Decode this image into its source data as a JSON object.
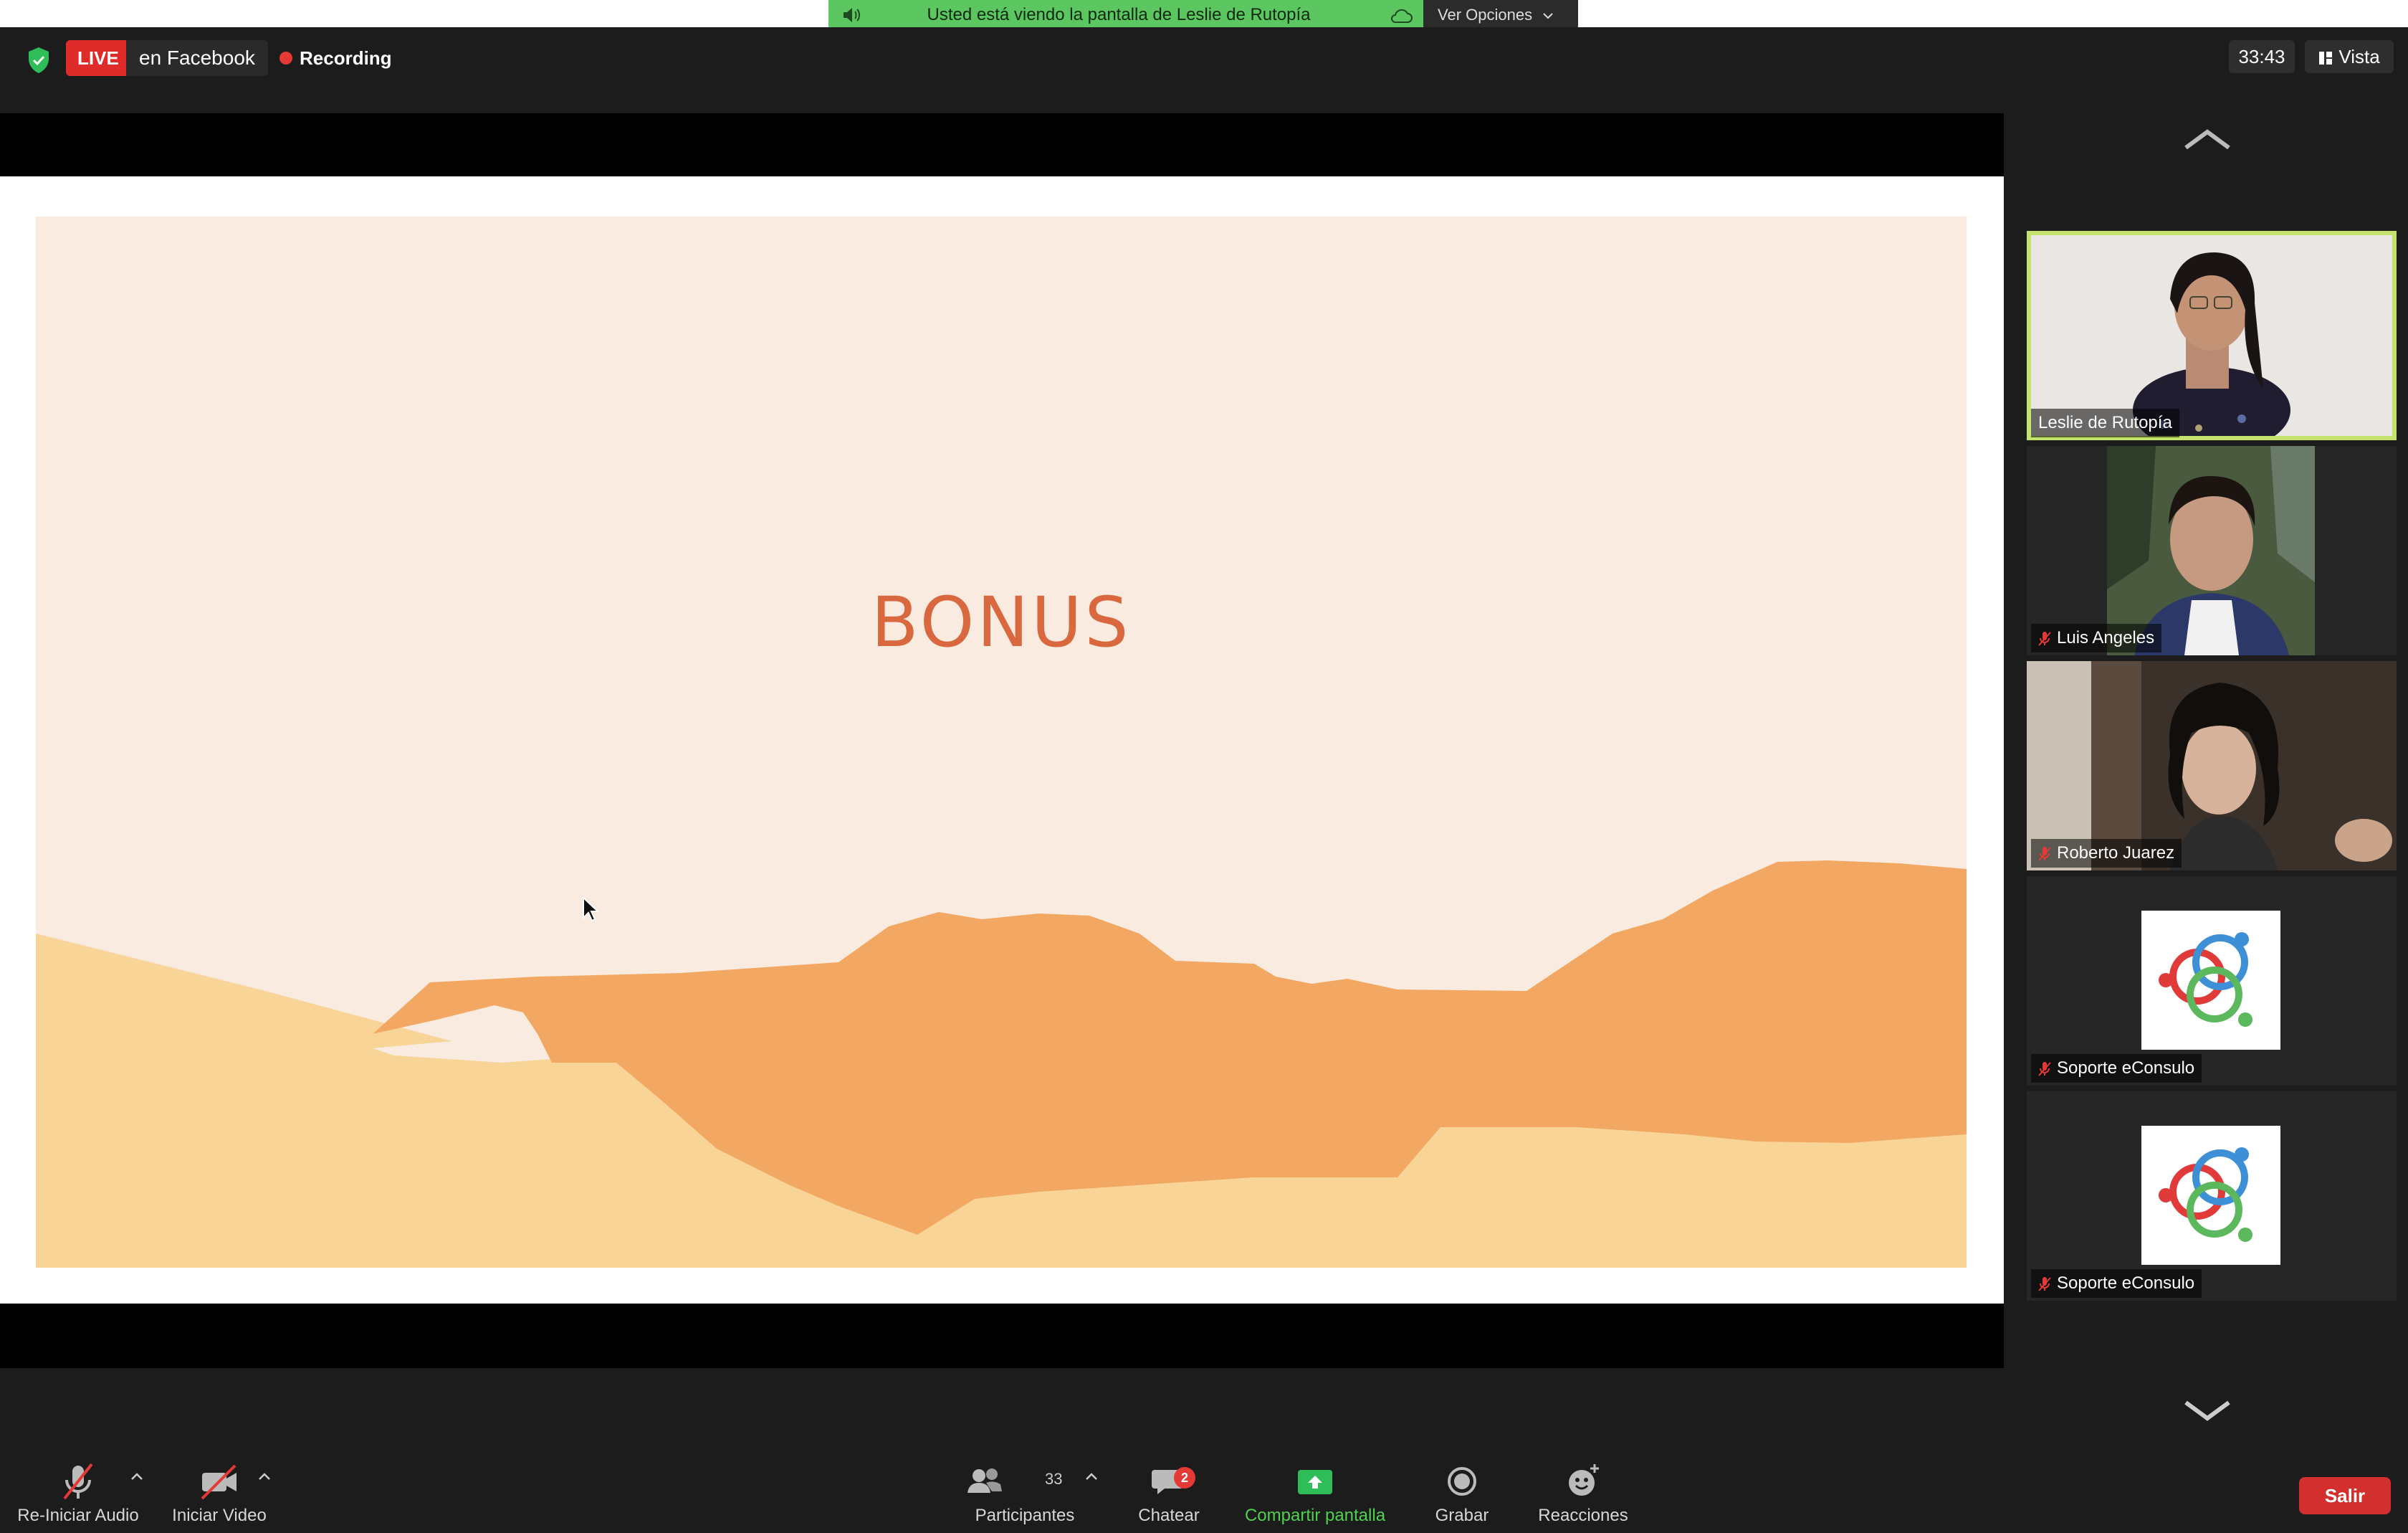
{
  "header": {
    "live_label": "LIVE",
    "live_platform": "en Facebook",
    "recording_label": "Recording",
    "share_banner": "Usted está viendo la pantalla de Leslie de Rutopía",
    "view_options": "Ver Opciones",
    "timer": "33:43",
    "view_label": "Vista"
  },
  "slide": {
    "title": "BONUS"
  },
  "participants": [
    {
      "name": "Leslie de Rutopía",
      "muted": false,
      "active_speaker": true
    },
    {
      "name": "Luis Angeles",
      "muted": true
    },
    {
      "name": "Roberto Juarez",
      "muted": true
    },
    {
      "name": "Soporte eConsulo",
      "muted": true
    },
    {
      "name": "Soporte eConsulo",
      "muted": true
    }
  ],
  "toolbar": {
    "audio_label": "Re-Iniciar Audio",
    "video_label": "Iniciar Video",
    "participants_label": "Participantes",
    "participants_count": "33",
    "chat_label": "Chatear",
    "chat_badge": "2",
    "share_label": "Compartir pantalla",
    "record_label": "Grabar",
    "reactions_label": "Reacciones",
    "exit_label": "Salir"
  },
  "colors": {
    "share_green": "#5cc660",
    "active_outline": "#c4e36d",
    "live_red": "#e02b2b",
    "slide_bg": "#f9ebe0",
    "slide_title": "#d9683f"
  }
}
